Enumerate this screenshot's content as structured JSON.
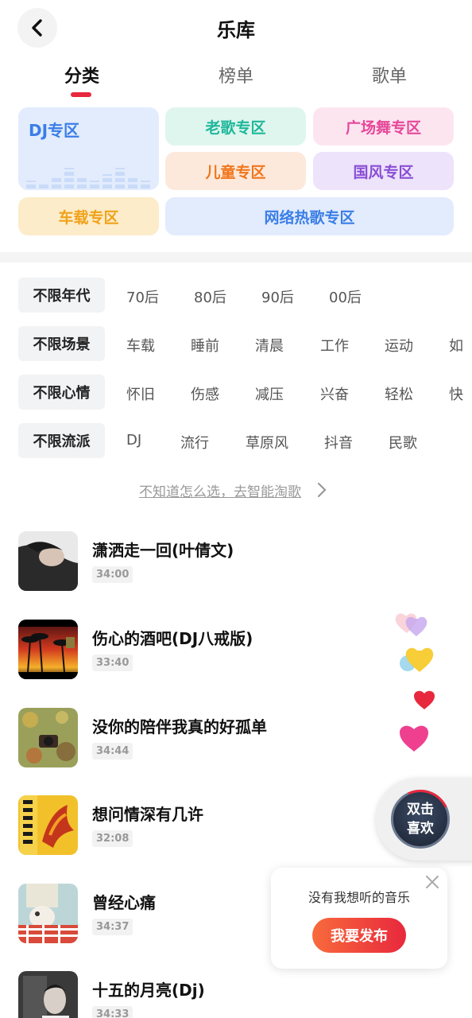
{
  "header": {
    "title": "乐库"
  },
  "tabs": [
    {
      "label": "分类",
      "active": true
    },
    {
      "label": "榜单",
      "active": false
    },
    {
      "label": "歌单",
      "active": false
    }
  ],
  "categories": [
    {
      "label": "DJ专区",
      "color": "#3b7ee6",
      "bg": "#e2ecfd"
    },
    {
      "label": "老歌专区",
      "color": "#1fb89a",
      "bg": "#dff6ef"
    },
    {
      "label": "广场舞专区",
      "color": "#e5489a",
      "bg": "#fde5f0"
    },
    {
      "label": "儿童专区",
      "color": "#f0761c",
      "bg": "#fde9dc"
    },
    {
      "label": "国风专区",
      "color": "#8a4ed6",
      "bg": "#ede3fb"
    },
    {
      "label": "车载专区",
      "color": "#f0a21a",
      "bg": "#fcecc9"
    },
    {
      "label": "网络热歌专区",
      "color": "#3b7ee6",
      "bg": "#e2ecfd"
    }
  ],
  "filters": [
    {
      "label": "不限年代",
      "options": [
        "70后",
        "80后",
        "90后",
        "00后"
      ]
    },
    {
      "label": "不限场景",
      "options": [
        "车载",
        "睡前",
        "清晨",
        "工作",
        "运动",
        "如"
      ]
    },
    {
      "label": "不限心情",
      "options": [
        "怀旧",
        "伤感",
        "减压",
        "兴奋",
        "轻松",
        "快"
      ]
    },
    {
      "label": "不限流派",
      "options": [
        "DJ",
        "流行",
        "草原风",
        "抖音",
        "民歌"
      ]
    }
  ],
  "hint": "不知道怎么选，去智能淘歌",
  "songs": [
    {
      "title": "潇洒走一回(叶倩文)",
      "duration": "34:00"
    },
    {
      "title": "伤心的酒吧(DJ八戒版)",
      "duration": "33:40"
    },
    {
      "title": "没你的陪伴我真的好孤单",
      "duration": "34:44"
    },
    {
      "title": "想问情深有几许",
      "duration": "32:08"
    },
    {
      "title": "曾经心痛",
      "duration": "34:37"
    },
    {
      "title": "十五的月亮(Dj)",
      "duration": "34:33"
    }
  ],
  "double_tap": {
    "line1": "双击",
    "line2": "喜欢"
  },
  "popup": {
    "text": "没有我想听的音乐",
    "button": "我要发布"
  },
  "colors": {
    "accent": "#e8283d"
  }
}
